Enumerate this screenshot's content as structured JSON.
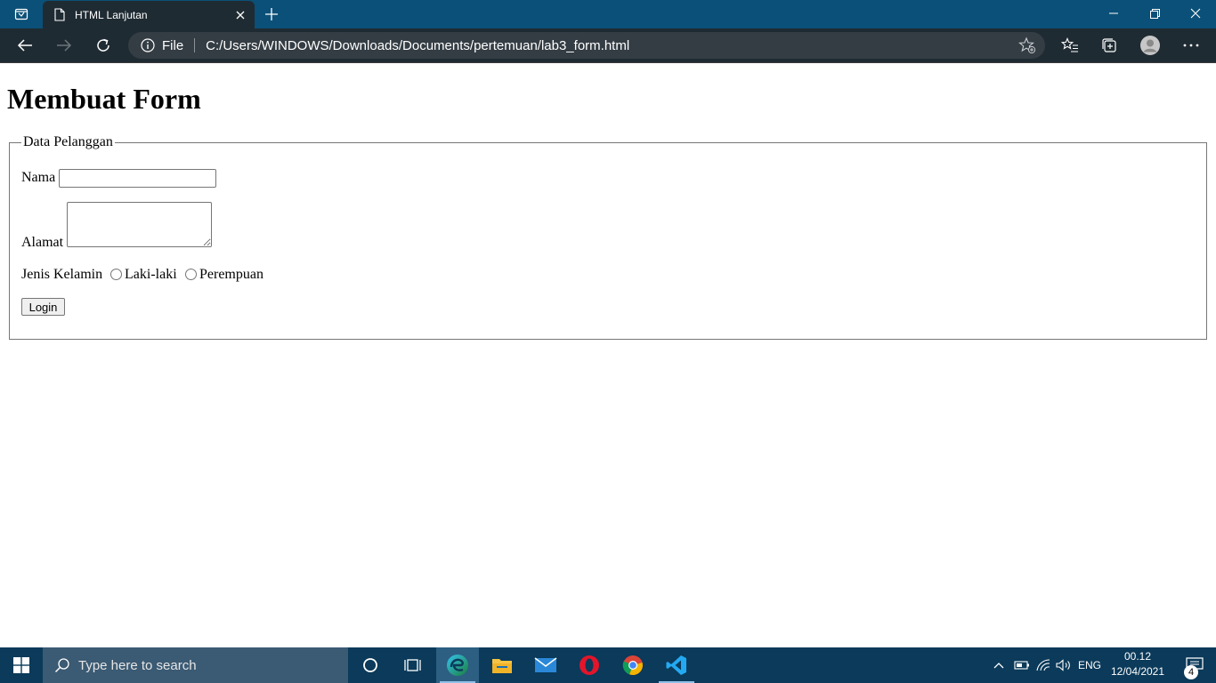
{
  "browser": {
    "tab": {
      "title": "HTML Lanjutan"
    },
    "address": {
      "scheme_label": "File",
      "url": "C:/Users/WINDOWS/Downloads/Documents/pertemuan/lab3_form.html"
    }
  },
  "page": {
    "heading": "Membuat Form",
    "fieldset_legend": "Data Pelanggan",
    "name_label": "Nama",
    "name_value": "",
    "address_label": "Alamat",
    "gender_label": "Jenis Kelamin",
    "gender_options": [
      "Laki-laki",
      "Perempuan"
    ],
    "submit_label": "Login"
  },
  "taskbar": {
    "search_placeholder": "Type here to search",
    "apps": [
      "cortana",
      "task-view",
      "edge",
      "file-explorer",
      "mail",
      "opera",
      "chrome",
      "vscode"
    ],
    "language": "ENG",
    "time": "00.12",
    "date": "12/04/2021",
    "notification_count": "4"
  }
}
